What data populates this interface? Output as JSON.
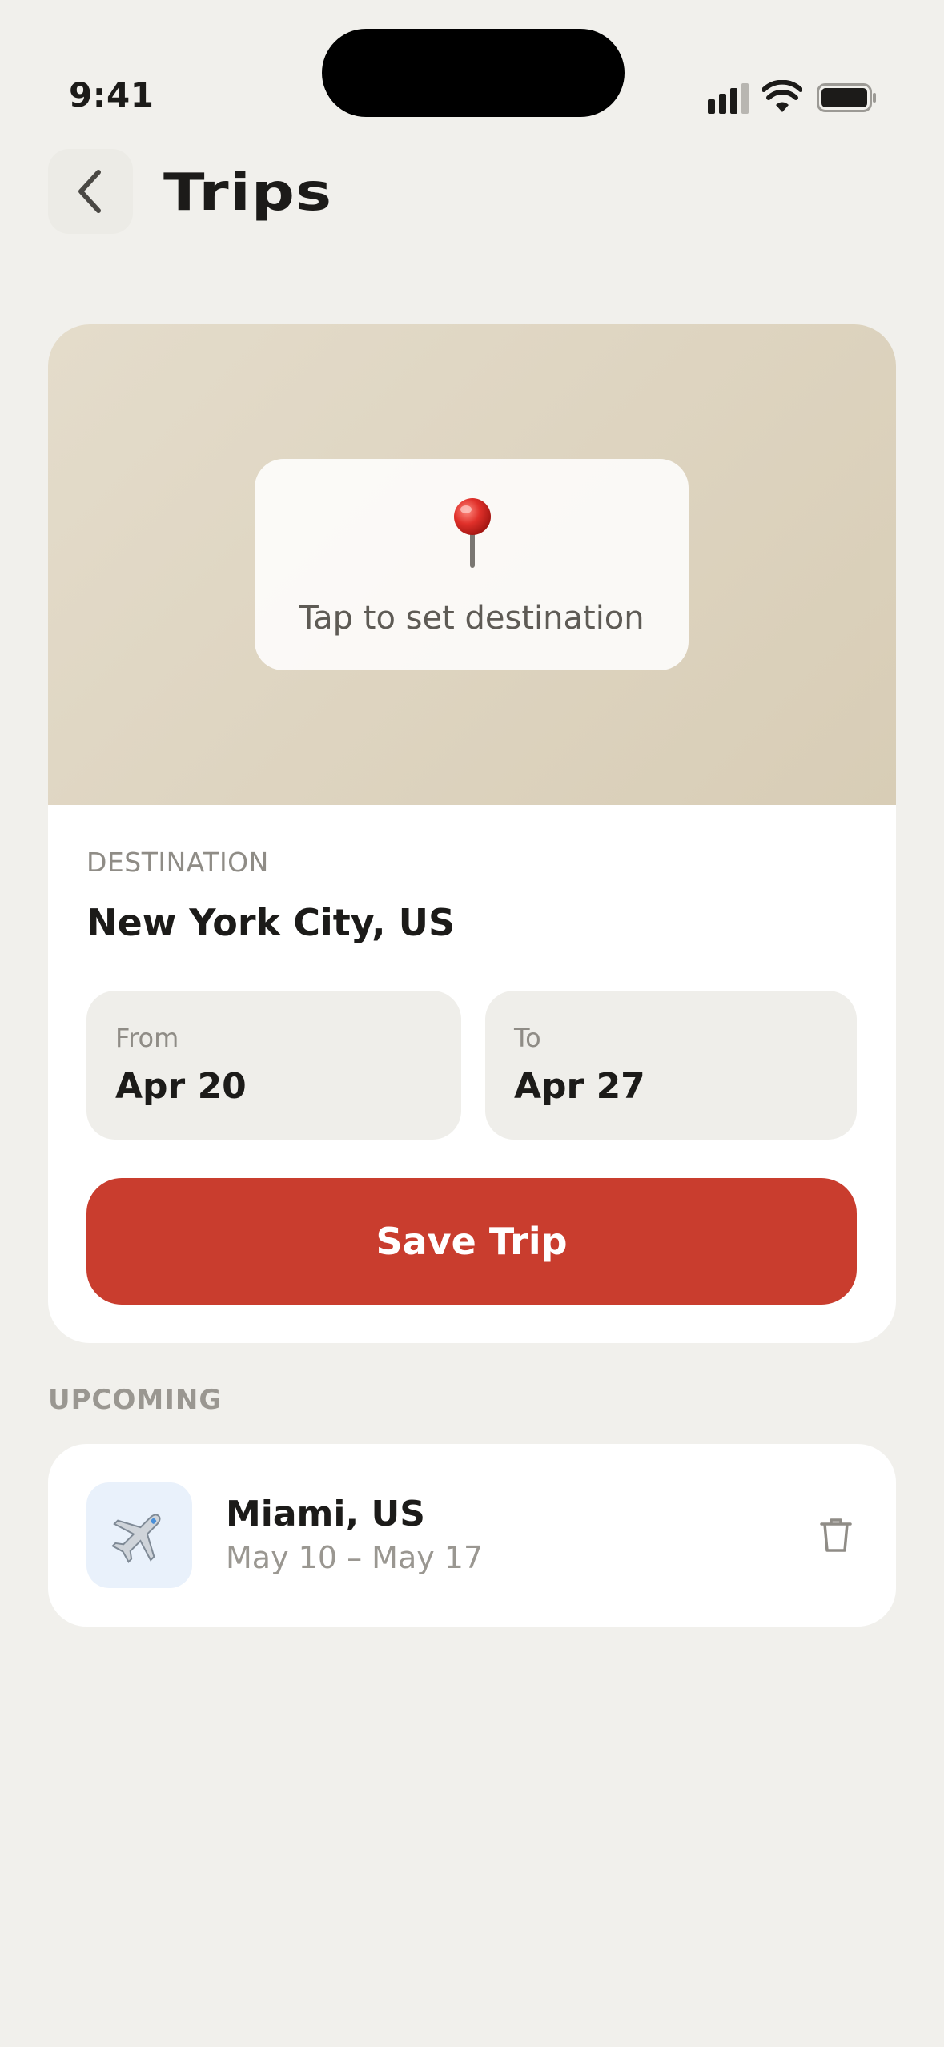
{
  "status_bar": {
    "time": "9:41"
  },
  "header": {
    "title": "Trips"
  },
  "map": {
    "prompt": "Tap to set destination"
  },
  "form": {
    "destination_label": "DESTINATION",
    "destination_value": "New York City, US",
    "from_label": "From",
    "from_value": "Apr 20",
    "to_label": "To",
    "to_value": "Apr 27",
    "save_label": "Save Trip"
  },
  "upcoming": {
    "section_label": "UPCOMING",
    "trips": [
      {
        "title": "Miami, US",
        "dates": "May 10 – May 17",
        "icon": "airplane-icon"
      }
    ]
  },
  "colors": {
    "background": "#f1f0ec",
    "accent": "#c93d2e",
    "card": "#ffffff",
    "map": "#ded5c2"
  }
}
